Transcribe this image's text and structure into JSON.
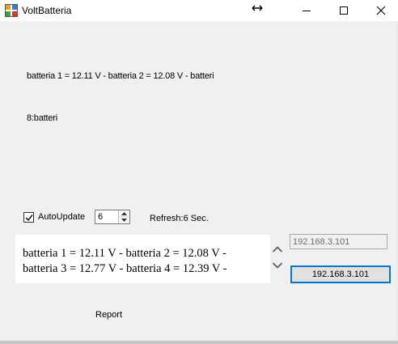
{
  "window": {
    "title": "VoltBatteria"
  },
  "status": {
    "line1": "batteria 1 = 12.11 V - batteria 2 = 12.08 V - batteri",
    "line2": "8:batteri"
  },
  "controls": {
    "autoupdate_label": "AutoUpdate",
    "autoupdate_checked": true,
    "spinner_value": "6",
    "refresh_label": "Refresh:6 Sec."
  },
  "output": {
    "line1": "batteria 1 = 12.11 V - batteria 2 = 12.08 V -",
    "line2": "batteria 3 = 12.77 V - batteria 4 = 12.39 V -"
  },
  "network": {
    "ip_field_value": "192.168.3.101",
    "ip_button_label": "192.168.3.101"
  },
  "report_label": "Report",
  "icons": {
    "app": "battery-app-icon",
    "resize": "resize-horizontal-icon",
    "minimize": "minimize-icon",
    "maximize": "maximize-icon",
    "close": "close-icon",
    "check": "checkmark-icon",
    "chevron_up": "chevron-up-icon",
    "chevron_down": "chevron-down-icon"
  }
}
